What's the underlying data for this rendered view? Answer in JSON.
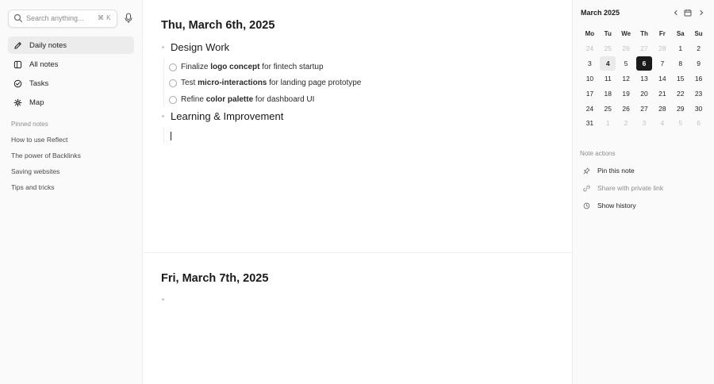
{
  "search": {
    "placeholder": "Search anything...",
    "shortcut": "⌘ K"
  },
  "sidebar": {
    "nav": [
      {
        "label": "Daily notes",
        "icon": "pen-icon",
        "active": true
      },
      {
        "label": "All notes",
        "icon": "notes-icon",
        "active": false
      },
      {
        "label": "Tasks",
        "icon": "check-circle-icon",
        "active": false
      },
      {
        "label": "Map",
        "icon": "map-graph-icon",
        "active": false
      }
    ],
    "pinned_heading": "Pinned notes",
    "pinned": [
      "How to use Reflect",
      "The power of Backlinks",
      "Saving websites",
      "Tips and tricks"
    ]
  },
  "days": [
    {
      "title": "Thu, March 6th, 2025",
      "sections": [
        {
          "heading": "Design Work",
          "tasks": [
            {
              "pre": "Finalize ",
              "bold": "logo concept",
              "post": " for fintech startup"
            },
            {
              "pre": "Test ",
              "bold": "micro-interactions",
              "post": " for landing page prototype"
            },
            {
              "pre": "Refine ",
              "bold": "color palette",
              "post": " for dashboard UI"
            }
          ]
        },
        {
          "heading": "Learning & Improvement",
          "tasks": []
        }
      ]
    },
    {
      "title": "Fri, March 7th, 2025",
      "sections": []
    }
  ],
  "calendar": {
    "month_label": "March 2025",
    "weekdays": [
      "Mo",
      "Tu",
      "We",
      "Th",
      "Fr",
      "Sa",
      "Su"
    ],
    "weeks": [
      [
        "24",
        "25",
        "26",
        "27",
        "28",
        "1",
        "2"
      ],
      [
        "3",
        "4",
        "5",
        "6",
        "7",
        "8",
        "9"
      ],
      [
        "10",
        "11",
        "12",
        "13",
        "14",
        "15",
        "16"
      ],
      [
        "17",
        "18",
        "19",
        "20",
        "21",
        "22",
        "23"
      ],
      [
        "24",
        "25",
        "26",
        "27",
        "28",
        "29",
        "30"
      ],
      [
        "31",
        "1",
        "2",
        "3",
        "4",
        "5",
        "6"
      ]
    ],
    "muted_leading": 5,
    "muted_trailing": 6,
    "today": "4",
    "selected": "6"
  },
  "note_actions": {
    "heading": "Note actions",
    "items": [
      {
        "label": "Pin this note",
        "icon": "pin-icon",
        "enabled": true
      },
      {
        "label": "Share with private link",
        "icon": "link-icon",
        "enabled": false
      },
      {
        "label": "Show history",
        "icon": "clock-icon",
        "enabled": true
      }
    ]
  },
  "colors": {
    "selected_day": "#1b1b1b",
    "today_day": "#eaeaea",
    "active_nav": "#ececec"
  }
}
